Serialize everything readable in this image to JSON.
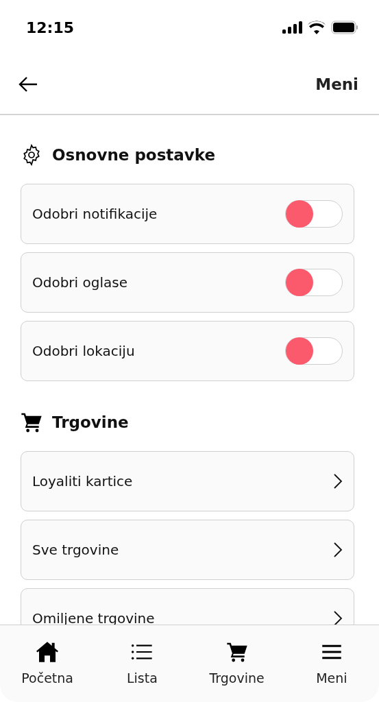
{
  "status_bar": {
    "time": "12:15"
  },
  "header": {
    "title": "Meni"
  },
  "sections": [
    {
      "title": "Osnovne postavke",
      "items": [
        {
          "kind": "toggle",
          "label": "Odobri notifikacije",
          "on": false
        },
        {
          "kind": "toggle",
          "label": "Odobri oglase",
          "on": false
        },
        {
          "kind": "toggle",
          "label": "Odobri lokaciju",
          "on": false
        }
      ]
    },
    {
      "title": "Trgovine",
      "items": [
        {
          "kind": "link",
          "label": "Loyaliti kartice"
        },
        {
          "kind": "link",
          "label": "Sve trgovine"
        },
        {
          "kind": "link",
          "label": "Omiljene trgovine"
        }
      ]
    }
  ],
  "tab_bar": [
    {
      "label": "Početna"
    },
    {
      "label": "Lista"
    },
    {
      "label": "Trgovine"
    },
    {
      "label": "Meni"
    }
  ]
}
